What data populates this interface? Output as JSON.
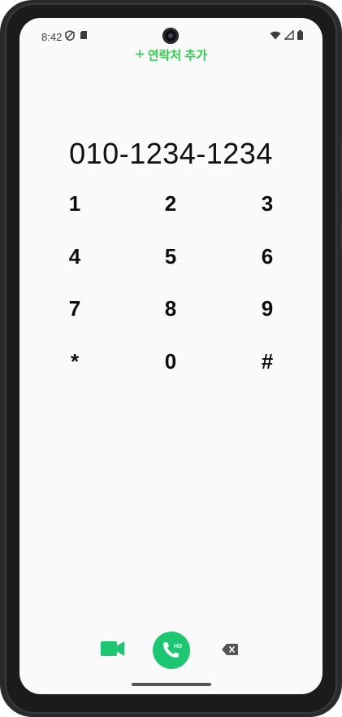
{
  "status_bar": {
    "time": "8:42",
    "left_icons": [
      "vpn-shield-icon",
      "sim-card-icon"
    ],
    "right_icons": [
      "wifi-icon",
      "cellular-signal-icon",
      "battery-icon"
    ]
  },
  "header": {
    "add_contact_plus": "+",
    "add_contact_label": "연락처 추가"
  },
  "dialer": {
    "number": "010-1234-1234",
    "keys": [
      "1",
      "2",
      "3",
      "4",
      "5",
      "6",
      "7",
      "8",
      "9",
      "*",
      "0",
      "#"
    ]
  },
  "actions": {
    "video_call_icon": "video-camera-icon",
    "call_icon": "phone-hd-icon",
    "call_badge": "HD",
    "backspace_icon": "backspace-icon"
  },
  "colors": {
    "accent_green": "#2ad14a",
    "call_button": "#1dc772",
    "screen_bg": "#fafafa"
  }
}
